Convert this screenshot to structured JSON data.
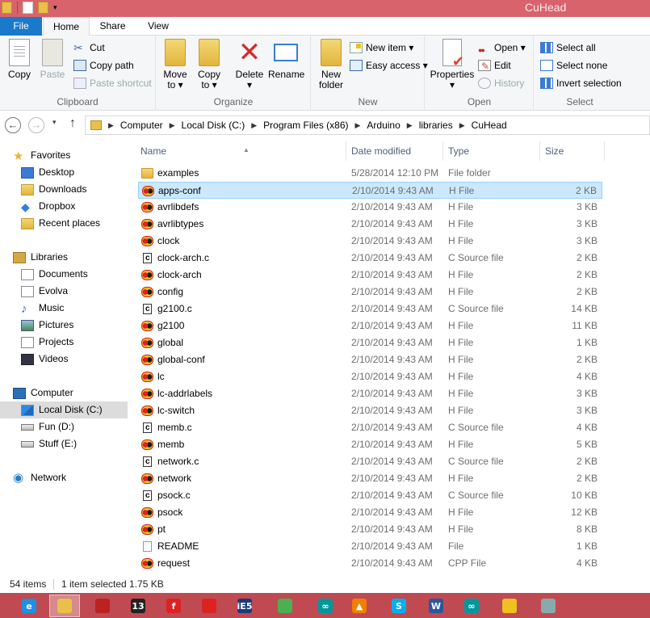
{
  "window": {
    "title": "CuHead"
  },
  "tabs": [
    "File",
    "Home",
    "Share",
    "View"
  ],
  "ribbon": {
    "clipboard": {
      "label": "Clipboard",
      "copy": "Copy",
      "paste": "Paste",
      "cut": "Cut",
      "copy_path": "Copy path",
      "paste_shortcut": "Paste shortcut"
    },
    "organize": {
      "label": "Organize",
      "move_to_1": "Move",
      "move_to_2": "to ▾",
      "copy_to_1": "Copy",
      "copy_to_2": "to ▾",
      "delete": "Delete",
      "delete_arrow": "▾",
      "rename": "Rename"
    },
    "new": {
      "label": "New",
      "new_folder_1": "New",
      "new_folder_2": "folder",
      "new_item": "New item ▾",
      "easy_access": "Easy access ▾"
    },
    "open": {
      "label": "Open",
      "properties": "Properties",
      "properties_arrow": "▾",
      "open": "Open ▾",
      "edit": "Edit",
      "history": "History"
    },
    "select": {
      "label": "Select",
      "select_all": "Select all",
      "select_none": "Select none",
      "invert_selection": "Invert selection"
    }
  },
  "address": {
    "back": "←",
    "forward": "→",
    "up": "↑",
    "crumbs": [
      "Computer",
      "Local Disk (C:)",
      "Program Files (x86)",
      "Arduino",
      "libraries",
      "CuHead"
    ]
  },
  "nav": {
    "favorites": "Favorites",
    "favorites_items": [
      "Desktop",
      "Downloads",
      "Dropbox",
      "Recent places"
    ],
    "libraries": "Libraries",
    "libraries_items": [
      "Documents",
      "Evolva",
      "Music",
      "Pictures",
      "Projects",
      "Videos"
    ],
    "computer": "Computer",
    "computer_items": [
      "Local Disk (C:)",
      "Fun (D:)",
      "Stuff (E:)"
    ],
    "network": "Network"
  },
  "columns": {
    "name": "Name",
    "date": "Date modified",
    "type": "Type",
    "size": "Size"
  },
  "files": [
    {
      "name": "examples",
      "date": "5/28/2014 12:10 PM",
      "type": "File folder",
      "size": "",
      "icon": "folder"
    },
    {
      "name": "apps-conf",
      "date": "2/10/2014 9:43 AM",
      "type": "H File",
      "size": "2 KB",
      "icon": "h-file"
    },
    {
      "name": "avrlibdefs",
      "date": "2/10/2014 9:43 AM",
      "type": "H File",
      "size": "3 KB",
      "icon": "h-file"
    },
    {
      "name": "avrlibtypes",
      "date": "2/10/2014 9:43 AM",
      "type": "H File",
      "size": "3 KB",
      "icon": "h-file"
    },
    {
      "name": "clock",
      "date": "2/10/2014 9:43 AM",
      "type": "H File",
      "size": "3 KB",
      "icon": "h-file"
    },
    {
      "name": "clock-arch.c",
      "date": "2/10/2014 9:43 AM",
      "type": "C Source file",
      "size": "2 KB",
      "icon": "c-file"
    },
    {
      "name": "clock-arch",
      "date": "2/10/2014 9:43 AM",
      "type": "H File",
      "size": "2 KB",
      "icon": "h-file"
    },
    {
      "name": "config",
      "date": "2/10/2014 9:43 AM",
      "type": "H File",
      "size": "2 KB",
      "icon": "h-file"
    },
    {
      "name": "g2100.c",
      "date": "2/10/2014 9:43 AM",
      "type": "C Source file",
      "size": "14 KB",
      "icon": "c-file"
    },
    {
      "name": "g2100",
      "date": "2/10/2014 9:43 AM",
      "type": "H File",
      "size": "11 KB",
      "icon": "h-file"
    },
    {
      "name": "global",
      "date": "2/10/2014 9:43 AM",
      "type": "H File",
      "size": "1 KB",
      "icon": "h-file"
    },
    {
      "name": "global-conf",
      "date": "2/10/2014 9:43 AM",
      "type": "H File",
      "size": "2 KB",
      "icon": "h-file"
    },
    {
      "name": "lc",
      "date": "2/10/2014 9:43 AM",
      "type": "H File",
      "size": "4 KB",
      "icon": "h-file"
    },
    {
      "name": "lc-addrlabels",
      "date": "2/10/2014 9:43 AM",
      "type": "H File",
      "size": "3 KB",
      "icon": "h-file"
    },
    {
      "name": "lc-switch",
      "date": "2/10/2014 9:43 AM",
      "type": "H File",
      "size": "3 KB",
      "icon": "h-file"
    },
    {
      "name": "memb.c",
      "date": "2/10/2014 9:43 AM",
      "type": "C Source file",
      "size": "4 KB",
      "icon": "c-file"
    },
    {
      "name": "memb",
      "date": "2/10/2014 9:43 AM",
      "type": "H File",
      "size": "5 KB",
      "icon": "h-file"
    },
    {
      "name": "network.c",
      "date": "2/10/2014 9:43 AM",
      "type": "C Source file",
      "size": "2 KB",
      "icon": "c-file"
    },
    {
      "name": "network",
      "date": "2/10/2014 9:43 AM",
      "type": "H File",
      "size": "2 KB",
      "icon": "h-file"
    },
    {
      "name": "psock.c",
      "date": "2/10/2014 9:43 AM",
      "type": "C Source file",
      "size": "10 KB",
      "icon": "c-file"
    },
    {
      "name": "psock",
      "date": "2/10/2014 9:43 AM",
      "type": "H File",
      "size": "12 KB",
      "icon": "h-file"
    },
    {
      "name": "pt",
      "date": "2/10/2014 9:43 AM",
      "type": "H File",
      "size": "8 KB",
      "icon": "h-file"
    },
    {
      "name": "README",
      "date": "2/10/2014 9:43 AM",
      "type": "File",
      "size": "1 KB",
      "icon": "file"
    },
    {
      "name": "request",
      "date": "2/10/2014 9:43 AM",
      "type": "CPP File",
      "size": "4 KB",
      "icon": "h-file"
    }
  ],
  "selected_file": "apps-conf",
  "status": {
    "items": "54 items",
    "selection": "1 item selected  1.75 KB"
  },
  "taskbar": {
    "items": [
      {
        "name": "internet-explorer",
        "glyph": "e",
        "color": "#1e90e6"
      },
      {
        "name": "file-explorer",
        "glyph": "",
        "color": "#e8c04a"
      },
      {
        "name": "app-red-circle",
        "glyph": "",
        "color": "#b22"
      },
      {
        "name": "app-13",
        "glyph": "13",
        "color": "#222"
      },
      {
        "name": "app-f",
        "glyph": "f",
        "color": "#d22"
      },
      {
        "name": "app-drop",
        "glyph": "",
        "color": "#d22"
      },
      {
        "name": "app-ie5",
        "glyph": "iE5",
        "color": "#1a3a7a"
      },
      {
        "name": "chrome",
        "glyph": "",
        "color": "#4caf50"
      },
      {
        "name": "arduino",
        "glyph": "∞",
        "color": "#00979c"
      },
      {
        "name": "vlc",
        "glyph": "▲",
        "color": "#f08000"
      },
      {
        "name": "skype",
        "glyph": "S",
        "color": "#00aff0"
      },
      {
        "name": "word",
        "glyph": "W",
        "color": "#2b579a"
      },
      {
        "name": "arduino-2",
        "glyph": "∞",
        "color": "#00979c"
      },
      {
        "name": "h-file-viewer",
        "glyph": "",
        "color": "#f0c020"
      },
      {
        "name": "notepad",
        "glyph": "",
        "color": "#8aa"
      }
    ]
  }
}
